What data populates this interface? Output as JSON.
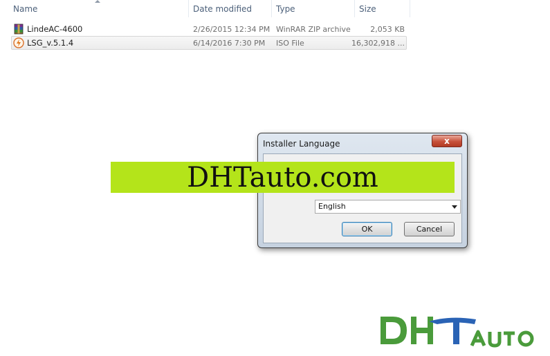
{
  "explorer": {
    "columns": {
      "name": "Name",
      "date_modified": "Date modified",
      "type": "Type",
      "size": "Size"
    },
    "files": [
      {
        "name": "LindeAC-4600",
        "date": "2/26/2015 12:34 PM",
        "type": "WinRAR ZIP archive",
        "size": "2,053 KB",
        "icon": "winrar-archive-icon"
      },
      {
        "name": "LSG_v.5.1.4",
        "date": "6/14/2016 7:30 PM",
        "type": "ISO File",
        "size": "16,302,918 ...",
        "icon": "iso-file-icon",
        "selected": true
      }
    ]
  },
  "dialog": {
    "title": "Installer Language",
    "close_label": "x",
    "language_selected": "English",
    "ok_label": "OK",
    "cancel_label": "Cancel"
  },
  "watermark": {
    "banner_text": "DHTauto.com",
    "logo_text": "DHTAUTO",
    "brand_green": "#4a9b3b",
    "brand_blue": "#2a63b5",
    "banner_color": "#b4e41a"
  }
}
